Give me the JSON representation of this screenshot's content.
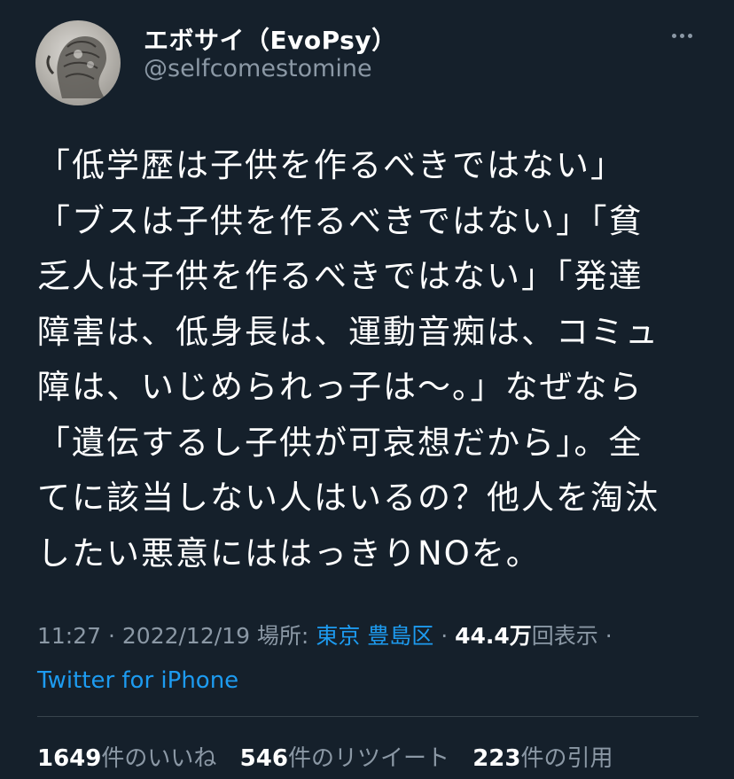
{
  "author": {
    "display_name": "エボサイ（EvoPsy）",
    "handle": "@selfcomestomine"
  },
  "tweet": {
    "lines": [
      "「低学歴は子供を作るべきではない」",
      "「ブスは子供を作るべきではない」「貧",
      "乏人は子供を作るべきではない」「発達",
      "障害は、低身長は、運動音痴は、コミュ",
      "障は、いじめられっ子は〜。」なぜなら",
      "「遺伝するし子供が可哀想だから」。全",
      "てに該当しない人はいるの？他人を淘汰",
      "したい悪意にははっきりNOを。"
    ]
  },
  "meta": {
    "time": "11:27",
    "sep1": " · ",
    "date": "2022/12/19",
    "location_label": " 場所: ",
    "location": "東京 豊島区",
    "sep2": " · ",
    "views_count": "44.4万",
    "views_label": "回表示",
    "sep3": " ·"
  },
  "source": "Twitter for iPhone",
  "stats": {
    "likes_count": "1649",
    "likes_label": "件のいいね",
    "retweets_count": "546",
    "retweets_label": "件のリツイート",
    "quotes_count": "223",
    "quotes_label": "件の引用"
  },
  "icons": {
    "more": "more-horizontal-icon",
    "avatar": "avatar"
  },
  "colors": {
    "background": "#15202b",
    "text": "#ffffff",
    "secondary": "#8b98a5",
    "accent": "#1d9bf0",
    "divider": "#38444d"
  }
}
